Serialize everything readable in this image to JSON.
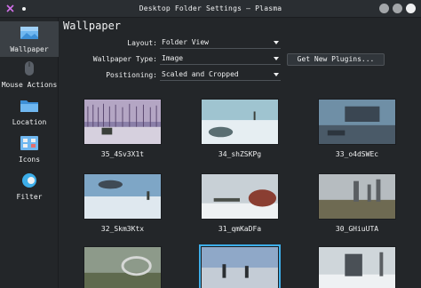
{
  "window": {
    "title": "Desktop Folder Settings — Plasma"
  },
  "sidebar": {
    "items": [
      {
        "label": "Wallpaper",
        "icon": "wallpaper-icon",
        "active": true
      },
      {
        "label": "Mouse Actions",
        "icon": "mouse-icon",
        "active": false
      },
      {
        "label": "Location",
        "icon": "folder-icon",
        "active": false
      },
      {
        "label": "Icons",
        "icon": "icons-grid-icon",
        "active": false
      },
      {
        "label": "Filter",
        "icon": "filter-icon",
        "active": false
      }
    ]
  },
  "main": {
    "title": "Wallpaper",
    "layout": {
      "label": "Layout:",
      "value": "Folder View"
    },
    "wallpaper_type": {
      "label": "Wallpaper Type:",
      "value": "Image"
    },
    "positioning": {
      "label": "Positioning:",
      "value": "Scaled and Cropped"
    },
    "get_plugins_label": "Get New Plugins..."
  },
  "wallpapers": [
    {
      "name": "35_4Sv3X1t",
      "selected": false
    },
    {
      "name": "34_shZSKPg",
      "selected": false
    },
    {
      "name": "33_o4dSWEc",
      "selected": false
    },
    {
      "name": "32_Skm3Ktx",
      "selected": false
    },
    {
      "name": "31_qmKaDFa",
      "selected": false
    },
    {
      "name": "30_GHiuUTA",
      "selected": false
    },
    {
      "name": "",
      "selected": false
    },
    {
      "name": "",
      "selected": true
    },
    {
      "name": "",
      "selected": false
    }
  ],
  "colors": {
    "background": "#232629",
    "accent": "#3daee9",
    "text": "#eff0f1"
  }
}
